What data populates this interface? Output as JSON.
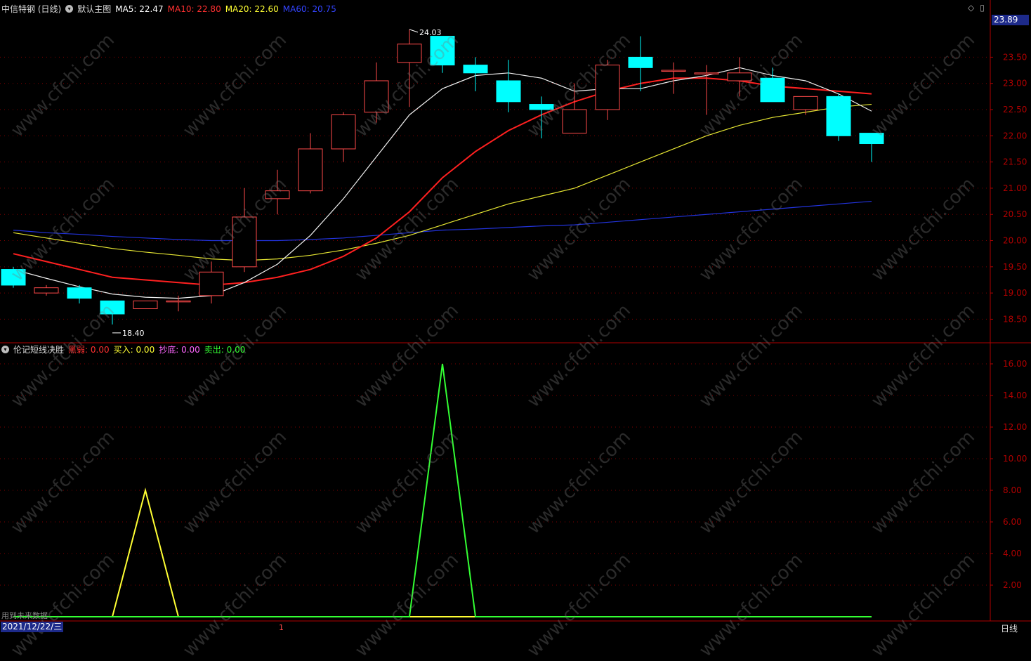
{
  "stock_title": "中信特钢 (日线)",
  "main_chart_name": "默认主图",
  "ma": [
    {
      "label": "MA5:",
      "value": "22.47",
      "color": "#ffffff"
    },
    {
      "label": "MA10:",
      "value": "22.80",
      "color": "#ff3030"
    },
    {
      "label": "MA20:",
      "value": "22.60",
      "color": "#ffff33"
    },
    {
      "label": "MA60:",
      "value": "20.75",
      "color": "#3344ff"
    }
  ],
  "current_price": "23.89",
  "indicator_name": "伦记短线决胜",
  "indicator_fields": [
    {
      "label": "黑弱:",
      "value": "0.00",
      "color": "#ff3030"
    },
    {
      "label": "买入:",
      "value": "0.00",
      "color": "#ffff33"
    },
    {
      "label": "抄底:",
      "value": "0.00",
      "color": "#ff66ff"
    },
    {
      "label": "卖出:",
      "value": "0.00",
      "color": "#33ff33"
    }
  ],
  "date_label": "2021/12/22/三",
  "period_label": "日线",
  "month_marker": "1",
  "note_text": "用到未来数据",
  "watermark_text": "www.cfchi.com",
  "colors": {
    "up": "#ff4a4a",
    "down": "#00ffff",
    "grid": "#800000",
    "axis": "#b00000"
  },
  "chart_data": [
    {
      "type": "candlestick",
      "y_ticks": [
        18.5,
        19.0,
        19.5,
        20.0,
        20.5,
        21.0,
        21.5,
        22.0,
        22.5,
        23.0,
        23.5
      ],
      "ylim": [
        18.05,
        24.35
      ],
      "high_annotation": "24.03",
      "low_annotation": "18.40",
      "candles": [
        {
          "o": 19.45,
          "h": 19.5,
          "l": 19.1,
          "c": 19.15
        },
        {
          "o": 19.0,
          "h": 19.15,
          "l": 18.95,
          "c": 19.1
        },
        {
          "o": 19.1,
          "h": 19.15,
          "l": 18.8,
          "c": 18.9
        },
        {
          "o": 18.85,
          "h": 18.85,
          "l": 18.4,
          "c": 18.6
        },
        {
          "o": 18.7,
          "h": 18.85,
          "l": 18.7,
          "c": 18.85
        },
        {
          "o": 18.85,
          "h": 18.95,
          "l": 18.65,
          "c": 18.85
        },
        {
          "o": 18.95,
          "h": 19.6,
          "l": 18.8,
          "c": 19.4
        },
        {
          "o": 19.5,
          "h": 21.0,
          "l": 19.4,
          "c": 20.45
        },
        {
          "o": 20.8,
          "h": 21.35,
          "l": 20.5,
          "c": 20.95
        },
        {
          "o": 20.95,
          "h": 22.05,
          "l": 20.9,
          "c": 21.75
        },
        {
          "o": 21.75,
          "h": 22.45,
          "l": 21.5,
          "c": 22.4
        },
        {
          "o": 22.45,
          "h": 23.4,
          "l": 22.25,
          "c": 23.05
        },
        {
          "o": 23.4,
          "h": 24.03,
          "l": 22.55,
          "c": 23.75
        },
        {
          "o": 23.9,
          "h": 23.9,
          "l": 23.2,
          "c": 23.35
        },
        {
          "o": 23.35,
          "h": 23.5,
          "l": 22.85,
          "c": 23.2
        },
        {
          "o": 23.05,
          "h": 23.45,
          "l": 22.45,
          "c": 22.65
        },
        {
          "o": 22.6,
          "h": 22.75,
          "l": 21.95,
          "c": 22.5
        },
        {
          "o": 22.05,
          "h": 23.0,
          "l": 22.05,
          "c": 22.5
        },
        {
          "o": 22.5,
          "h": 23.45,
          "l": 22.3,
          "c": 23.35
        },
        {
          "o": 23.5,
          "h": 23.9,
          "l": 22.85,
          "c": 23.3
        },
        {
          "o": 23.25,
          "h": 23.4,
          "l": 22.8,
          "c": 23.25
        },
        {
          "o": 23.2,
          "h": 23.35,
          "l": 22.4,
          "c": 23.2
        },
        {
          "o": 23.05,
          "h": 23.5,
          "l": 22.75,
          "c": 23.2
        },
        {
          "o": 23.1,
          "h": 23.3,
          "l": 22.7,
          "c": 22.65
        },
        {
          "o": 22.5,
          "h": 22.75,
          "l": 22.4,
          "c": 22.75
        },
        {
          "o": 22.75,
          "h": 22.8,
          "l": 21.9,
          "c": 22.0
        },
        {
          "o": 22.05,
          "h": 22.05,
          "l": 21.5,
          "c": 21.85
        }
      ],
      "ma5": [
        19.45,
        19.28,
        19.12,
        18.98,
        18.92,
        18.9,
        18.95,
        19.2,
        19.55,
        20.1,
        20.8,
        21.6,
        22.4,
        22.9,
        23.15,
        23.2,
        23.1,
        22.85,
        22.9,
        22.9,
        23.05,
        23.15,
        23.3,
        23.15,
        23.05,
        22.8,
        22.47
      ],
      "ma10": [
        19.75,
        19.6,
        19.45,
        19.3,
        19.25,
        19.2,
        19.15,
        19.2,
        19.3,
        19.45,
        19.7,
        20.05,
        20.55,
        21.2,
        21.7,
        22.1,
        22.4,
        22.65,
        22.85,
        23.0,
        23.1,
        23.1,
        23.05,
        22.95,
        22.9,
        22.85,
        22.8
      ],
      "ma20": [
        20.15,
        20.05,
        19.95,
        19.85,
        19.78,
        19.72,
        19.65,
        19.62,
        19.65,
        19.72,
        19.82,
        19.95,
        20.1,
        20.3,
        20.5,
        20.7,
        20.85,
        21.0,
        21.25,
        21.5,
        21.75,
        22.0,
        22.2,
        22.35,
        22.45,
        22.55,
        22.6
      ],
      "ma60": [
        20.2,
        20.15,
        20.12,
        20.08,
        20.05,
        20.02,
        20.0,
        20.0,
        20.0,
        20.02,
        20.05,
        20.1,
        20.15,
        20.2,
        20.22,
        20.25,
        20.28,
        20.3,
        20.35,
        20.4,
        20.45,
        20.5,
        20.55,
        20.6,
        20.65,
        20.7,
        20.75
      ]
    },
    {
      "type": "line",
      "y_ticks": [
        2.0,
        4.0,
        6.0,
        8.0,
        10.0,
        12.0,
        14.0,
        16.0
      ],
      "ylim": [
        0,
        16.8
      ],
      "series": [
        {
          "name": "买入:",
          "color": "#ffff33",
          "values": [
            0,
            0,
            0,
            0,
            8,
            0,
            0,
            0,
            0,
            0,
            0,
            0,
            0,
            0,
            0,
            0,
            0,
            0,
            0,
            0,
            0,
            0,
            0,
            0,
            0,
            0,
            0
          ]
        },
        {
          "name": "卖出:",
          "color": "#33ff33",
          "values": [
            0,
            0,
            0,
            0,
            0,
            0,
            0,
            0,
            0,
            0,
            0,
            0,
            0,
            16,
            0,
            0,
            0,
            0,
            0,
            0,
            0,
            0,
            0,
            0,
            0,
            0,
            0
          ]
        }
      ]
    }
  ]
}
